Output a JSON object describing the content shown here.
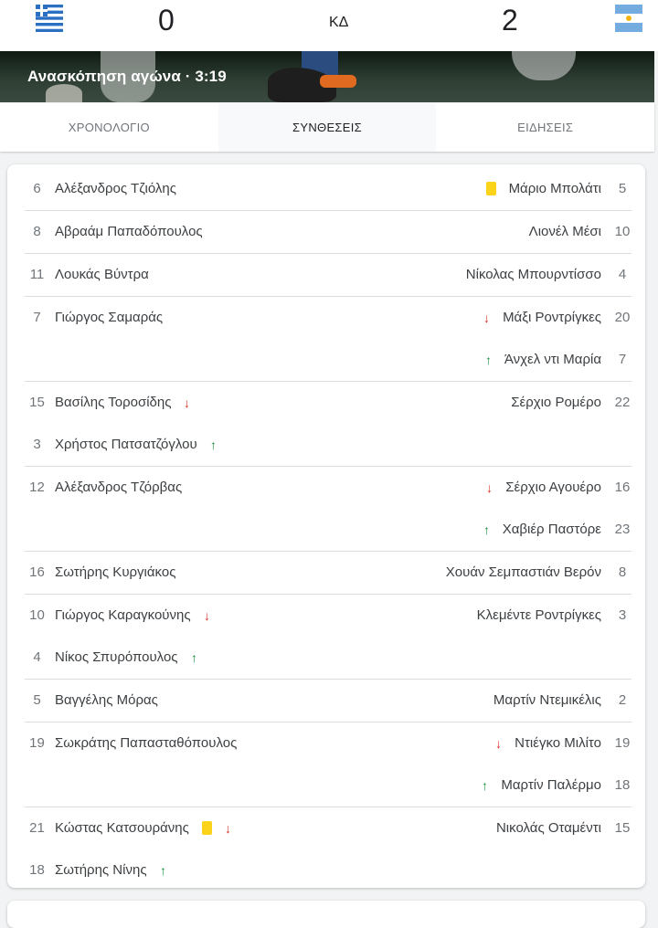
{
  "match": {
    "home_score": "0",
    "away_score": "2",
    "status": "ΚΔ",
    "home_flag": "greece-flag",
    "away_flag": "argentina-flag"
  },
  "highlights": {
    "title": "Ανασκόπηση αγώνα · 3:19"
  },
  "tabs": [
    {
      "label": "ΧΡΟΝΟΛΟΓΙΟ",
      "active": false
    },
    {
      "label": "ΣΥΝΘΕΣΕΙΣ",
      "active": true
    },
    {
      "label": "ΕΙΔΗΣΕΙΣ",
      "active": false
    }
  ],
  "colors": {
    "sub_out": "#d93025",
    "sub_in": "#1e8e3e",
    "yellow_card": "#fbd31b"
  },
  "lineups": [
    {
      "home": [
        {
          "num": "6",
          "name": "Αλέξανδρος Τζιόλης",
          "icons": []
        }
      ],
      "away": [
        {
          "num": "5",
          "name": "Μάριο Μπολάτι",
          "icons": [
            "yellow-card"
          ]
        }
      ]
    },
    {
      "home": [
        {
          "num": "8",
          "name": "Αβραάμ Παπαδόπουλος",
          "icons": []
        }
      ],
      "away": [
        {
          "num": "10",
          "name": "Λιονέλ Μέσι",
          "icons": []
        }
      ]
    },
    {
      "home": [
        {
          "num": "11",
          "name": "Λουκάς Βύντρα",
          "icons": []
        }
      ],
      "away": [
        {
          "num": "4",
          "name": "Νίκολας Μπουρντίσσο",
          "icons": []
        }
      ]
    },
    {
      "home": [
        {
          "num": "7",
          "name": "Γιώργος Σαμαράς",
          "icons": []
        }
      ],
      "away": [
        {
          "num": "20",
          "name": "Μάξι Ροντρίγκες",
          "icons": [
            "sub-out"
          ]
        },
        {
          "num": "7",
          "name": "Άνχελ ντι Μαρία",
          "icons": [
            "sub-in"
          ]
        }
      ]
    },
    {
      "home": [
        {
          "num": "15",
          "name": "Βασίλης Τοροσίδης",
          "icons": [
            "sub-out"
          ]
        },
        {
          "num": "3",
          "name": "Χρήστος Πατσατζόγλου",
          "icons": [
            "sub-in"
          ]
        }
      ],
      "away": [
        {
          "num": "22",
          "name": "Σέρχιο Ρομέρο",
          "icons": []
        }
      ]
    },
    {
      "home": [
        {
          "num": "12",
          "name": "Αλέξανδρος Τζόρβας",
          "icons": []
        }
      ],
      "away": [
        {
          "num": "16",
          "name": "Σέρχιο Αγουέρο",
          "icons": [
            "sub-out"
          ]
        },
        {
          "num": "23",
          "name": "Χαβιέρ Παστόρε",
          "icons": [
            "sub-in"
          ]
        }
      ]
    },
    {
      "home": [
        {
          "num": "16",
          "name": "Σωτήρης Κυργιάκος",
          "icons": []
        }
      ],
      "away": [
        {
          "num": "8",
          "name": "Χουάν Σεμπαστιάν Βερόν",
          "icons": []
        }
      ]
    },
    {
      "home": [
        {
          "num": "10",
          "name": "Γιώργος Καραγκούνης",
          "icons": [
            "sub-out"
          ]
        },
        {
          "num": "4",
          "name": "Νίκος Σπυρόπουλος",
          "icons": [
            "sub-in"
          ]
        }
      ],
      "away": [
        {
          "num": "3",
          "name": "Κλεμέντε Ροντρίγκες",
          "icons": []
        }
      ]
    },
    {
      "home": [
        {
          "num": "5",
          "name": "Βαγγέλης Μόρας",
          "icons": []
        }
      ],
      "away": [
        {
          "num": "2",
          "name": "Μαρτίν Ντεμικέλις",
          "icons": []
        }
      ]
    },
    {
      "home": [
        {
          "num": "19",
          "name": "Σωκράτης Παπασταθόπουλος",
          "icons": []
        }
      ],
      "away": [
        {
          "num": "19",
          "name": "Ντιέγκο Μιλίτο",
          "icons": [
            "sub-out"
          ]
        },
        {
          "num": "18",
          "name": "Μαρτίν Παλέρμο",
          "icons": [
            "sub-in"
          ]
        }
      ]
    },
    {
      "home": [
        {
          "num": "21",
          "name": "Κώστας Κατσουράνης",
          "icons": [
            "yellow-card",
            "sub-out"
          ]
        },
        {
          "num": "18",
          "name": "Σωτήρης Νίνης",
          "icons": [
            "sub-in"
          ]
        }
      ],
      "away": [
        {
          "num": "15",
          "name": "Νικολάς Οταμέντι",
          "icons": []
        }
      ]
    }
  ]
}
